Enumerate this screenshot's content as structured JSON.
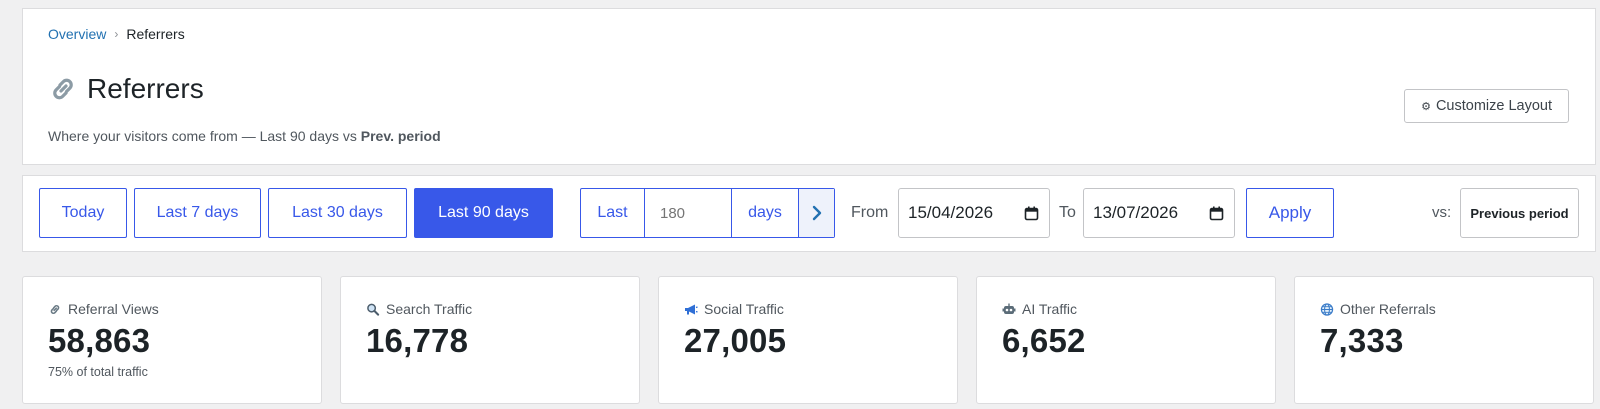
{
  "breadcrumb": {
    "parent": "Overview",
    "separator": "›",
    "current": "Referrers"
  },
  "header": {
    "title": "Referrers",
    "subtitle_prefix": "Where your visitors come from — Last 90 days vs ",
    "subtitle_bold": "Prev. period",
    "customize_label": "Customize Layout",
    "customize_icon": "⚙"
  },
  "filters": {
    "presets": [
      "Today",
      "Last 7 days",
      "Last 30 days",
      "Last 90 days"
    ],
    "active_preset": "Last 90 days",
    "last_label": "Last",
    "last_value": "180",
    "last_unit": "days",
    "from_label": "From",
    "from_date": "15/04/2026",
    "to_label": "To",
    "to_date": "13/07/2026",
    "apply_label": "Apply",
    "vs_label": "vs:",
    "vs_value": "Previous period"
  },
  "stats": [
    {
      "icon": "link-icon",
      "label": "Referral Views",
      "value": "58,863",
      "note": "75% of total traffic"
    },
    {
      "icon": "magnifier-icon",
      "label": "Search Traffic",
      "value": "16,778",
      "note": ""
    },
    {
      "icon": "megaphone-icon",
      "label": "Social Traffic",
      "value": "27,005",
      "note": ""
    },
    {
      "icon": "robot-icon",
      "label": "AI Traffic",
      "value": "6,652",
      "note": ""
    },
    {
      "icon": "globe-icon",
      "label": "Other Referrals",
      "value": "7,333",
      "note": ""
    }
  ],
  "colors": {
    "accent": "#3858e9",
    "link": "#2271b1",
    "background": "#f0f0f1"
  }
}
